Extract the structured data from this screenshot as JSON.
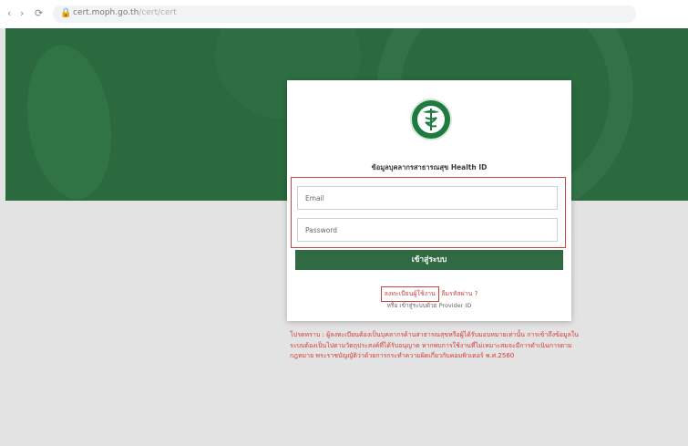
{
  "browser": {
    "back": "‹",
    "forward": "›",
    "reload": "⟳",
    "url_host": "cert.moph.go.th",
    "url_path": "/cert/cert"
  },
  "card": {
    "title": "ข้อมูลบุคลากรสาธารณสุข Health ID",
    "email_placeholder": "Email",
    "password_placeholder": "Password",
    "login_button": "เข้าสู่ระบบ",
    "register_link": "ลงทะเบียนผู้ใช้งาน",
    "forgot_link": "ลืมรหัสผ่าน ?",
    "subtext": "หรือ เข้าสู่ระบบด้วย Provider ID"
  },
  "notice": {
    "text": "โปรดทราบ : ผู้ลงทะเบียนต้องเป็นบุคลากรด้านสาธารณสุขหรือผู้ได้รับมอบหมายเท่านั้น การเข้าถึงข้อมูลในระบบต้องเป็นไปตามวัตถุประสงค์ที่ได้รับอนุญาต หากพบการใช้งานที่ไม่เหมาะสมจะมีการดำเนินการตามกฎหมาย พระราชบัญญัติว่าด้วยการกระทำความผิดเกี่ยวกับคอมพิวเตอร์ พ.ศ.2560"
  },
  "colors": {
    "brand_green": "#2a6a3e",
    "button_green": "#2f6a42",
    "alert_red": "#d63a3a"
  }
}
